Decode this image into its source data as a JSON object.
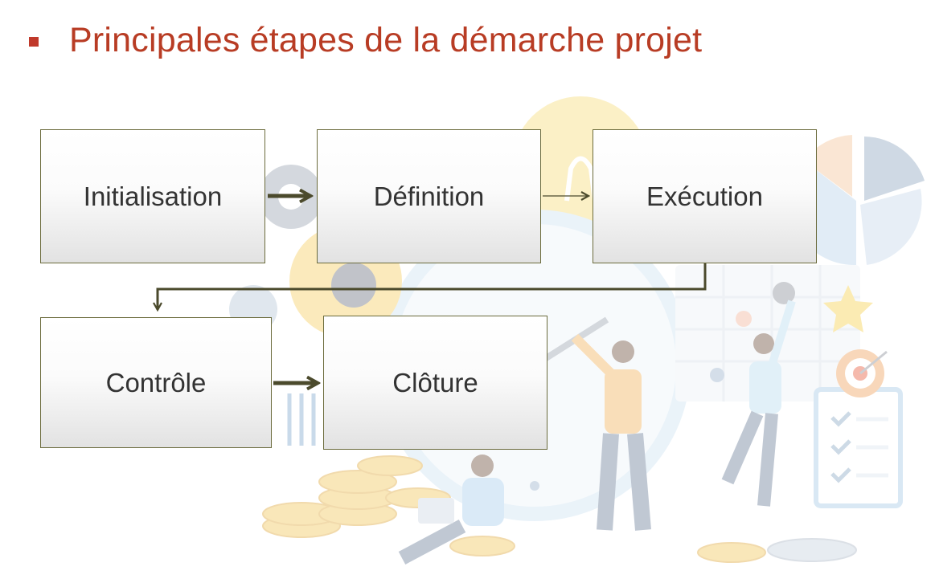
{
  "slide": {
    "title": "Principales étapes de la démarche projet",
    "colors": {
      "title": "#B83C24",
      "bullet": "#C0392B",
      "arrow": "#4B4A2C",
      "box_border": "#6B6B3C"
    }
  },
  "diagram": {
    "steps": [
      {
        "id": "initialisation",
        "label": "Initialisation"
      },
      {
        "id": "definition",
        "label": "Définition"
      },
      {
        "id": "execution",
        "label": "Exécution"
      },
      {
        "id": "controle",
        "label": "Contrôle"
      },
      {
        "id": "cloture",
        "label": "Clôture"
      }
    ],
    "connections": [
      {
        "from": "initialisation",
        "to": "definition",
        "style": "thick"
      },
      {
        "from": "definition",
        "to": "execution",
        "style": "thin"
      },
      {
        "from": "execution",
        "to": "controle",
        "style": "elbow"
      },
      {
        "from": "controle",
        "to": "cloture",
        "style": "thick"
      }
    ]
  },
  "background_illustration": {
    "elements": [
      "gear-icon",
      "lightbulb-icon",
      "clock-icon",
      "pie-chart-icon",
      "checklist-icon",
      "target-icon",
      "coins-icon",
      "star-icon",
      "people-illustration"
    ]
  }
}
